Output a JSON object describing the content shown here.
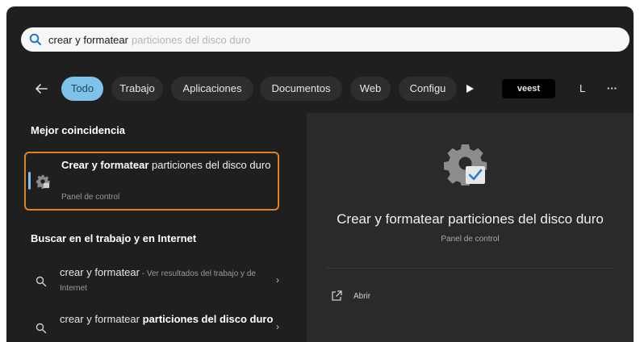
{
  "search": {
    "typed": "crear y formatear",
    "ghost": "particiones del disco duro"
  },
  "tabs": [
    {
      "label": "Todo"
    },
    {
      "label": "Trabajo"
    },
    {
      "label": "Aplicaciones"
    },
    {
      "label": "Documentos"
    },
    {
      "label": "Web"
    },
    {
      "label": "Configu"
    },
    {
      "label": "veest"
    },
    {
      "label": "L"
    },
    {
      "label": "···"
    }
  ],
  "best_match": {
    "title": "Mejor coincidencia",
    "name_bold": "Crear y formatear",
    "name_rest": " particiones del disco duro",
    "subtitle": "Panel de control"
  },
  "web_section": {
    "title": "Buscar en el trabajo y en Internet",
    "results": [
      {
        "bold": "crear y formatear",
        "rest": " - Ver resultados del trabajo y de Internet"
      },
      {
        "plain": "crear y formatear ",
        "bold": "particiones del disco duro"
      }
    ]
  },
  "preview": {
    "title": "Crear y formatear particiones del disco duro",
    "subtitle": "Panel de control",
    "open_label": "Abrir"
  },
  "colors": {
    "accent": "#7fc3ea",
    "highlight_border": "#e67e22"
  }
}
